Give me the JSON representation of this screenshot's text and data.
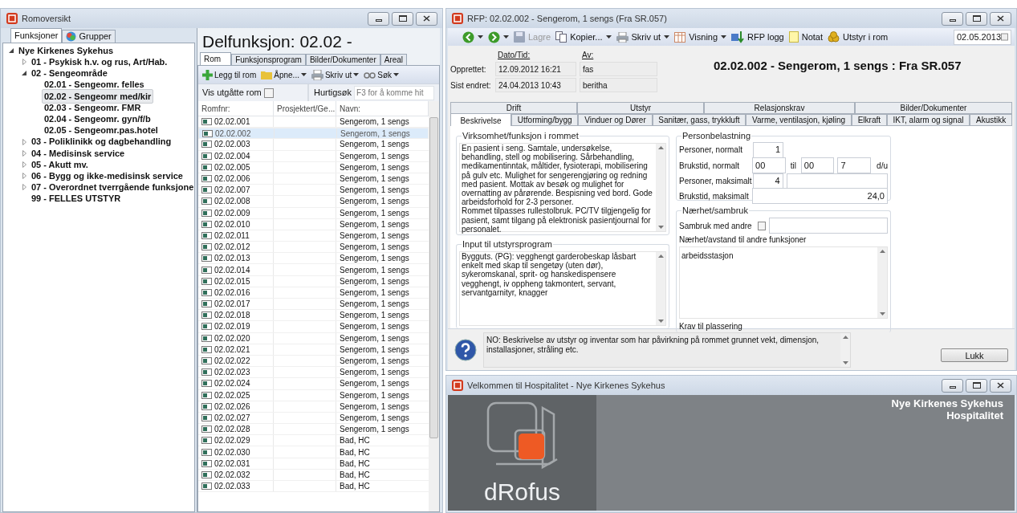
{
  "left_window": {
    "title": "Romoversikt",
    "tabs": [
      {
        "label": "Funksjoner",
        "selected": true
      },
      {
        "label": "Grupper",
        "selected": false
      }
    ],
    "tree": [
      {
        "label": "Nye Kirkenes Sykehus",
        "expanded": true,
        "selected": false,
        "children": [
          {
            "label": "01 - Psykisk h.v. og rus, Art/Hab.",
            "expanded": false,
            "selected": false
          },
          {
            "label": "02 - Sengeområde",
            "expanded": true,
            "selected": false,
            "children": [
              {
                "label": "02.01 - Sengeomr. felles",
                "selected": false
              },
              {
                "label": "02.02 - Sengeomr med/kir",
                "selected": true
              },
              {
                "label": "02.03 - Sengeomr. FMR",
                "selected": false
              },
              {
                "label": "02.04 - Sengeomr. gyn/f/b",
                "selected": false
              },
              {
                "label": "02.05 - Sengeomr.pas.hotel",
                "selected": false
              }
            ]
          },
          {
            "label": "03 - Poliklinikk og dagbehandling",
            "expanded": false,
            "selected": false
          },
          {
            "label": "04 - Medisinsk service",
            "expanded": false,
            "selected": false
          },
          {
            "label": "05 - Akutt mv.",
            "expanded": false,
            "selected": false
          },
          {
            "label": "06 - Bygg og ikke-medisinsk service",
            "expanded": false,
            "selected": false
          },
          {
            "label": "07 - Overordnet tverrgående funksjone",
            "expanded": false,
            "selected": false
          },
          {
            "label": "99 - FELLES UTSTYR",
            "selected": false
          }
        ]
      }
    ],
    "heading": "Delfunksjon: 02.02 -",
    "sub_tabs": [
      {
        "label": "Rom",
        "selected": true
      },
      {
        "label": "Funksjonsprogram",
        "selected": false
      },
      {
        "label": "Bilder/Dokumenter",
        "selected": false
      },
      {
        "label": "Areal",
        "selected": false
      }
    ],
    "toolbar": [
      {
        "label": "Legg til rom",
        "kind": "add",
        "dropdown": false
      },
      {
        "label": "Åpne...",
        "kind": "folder",
        "dropdown": true
      },
      {
        "label": "Skriv ut",
        "kind": "printer",
        "dropdown": true
      },
      {
        "label": "Søk",
        "kind": "glasses",
        "dropdown": true
      }
    ],
    "show_expired": {
      "label": "Vis utgåtte rom",
      "checked": false
    },
    "quick_search": {
      "label": "Hurtigsøk",
      "placeholder": "F3 for å komme hit"
    },
    "table": {
      "columns": [
        "Romfnr:",
        "Prosjektert/Ge...",
        "Navn:"
      ],
      "rows": [
        {
          "id": "02.02.001",
          "name": "Sengerom, 1 sengs",
          "selected": false
        },
        {
          "id": "02.02.002",
          "name": "Sengerom, 1 sengs",
          "selected": true
        },
        {
          "id": "02.02.003",
          "name": "Sengerom, 1 sengs",
          "selected": false
        },
        {
          "id": "02.02.004",
          "name": "Sengerom, 1 sengs",
          "selected": false
        },
        {
          "id": "02.02.005",
          "name": "Sengerom, 1 sengs",
          "selected": false
        },
        {
          "id": "02.02.006",
          "name": "Sengerom, 1 sengs",
          "selected": false
        },
        {
          "id": "02.02.007",
          "name": "Sengerom, 1 sengs",
          "selected": false
        },
        {
          "id": "02.02.008",
          "name": "Sengerom, 1 sengs",
          "selected": false
        },
        {
          "id": "02.02.009",
          "name": "Sengerom, 1 sengs",
          "selected": false
        },
        {
          "id": "02.02.010",
          "name": "Sengerom, 1 sengs",
          "selected": false
        },
        {
          "id": "02.02.011",
          "name": "Sengerom, 1 sengs",
          "selected": false
        },
        {
          "id": "02.02.012",
          "name": "Sengerom, 1 sengs",
          "selected": false
        },
        {
          "id": "02.02.013",
          "name": "Sengerom, 1 sengs",
          "selected": false
        },
        {
          "id": "02.02.014",
          "name": "Sengerom, 1 sengs",
          "selected": false
        },
        {
          "id": "02.02.015",
          "name": "Sengerom, 1 sengs",
          "selected": false
        },
        {
          "id": "02.02.016",
          "name": "Sengerom, 1 sengs",
          "selected": false
        },
        {
          "id": "02.02.017",
          "name": "Sengerom, 1 sengs",
          "selected": false
        },
        {
          "id": "02.02.018",
          "name": "Sengerom, 1 sengs",
          "selected": false
        },
        {
          "id": "02.02.019",
          "name": "Sengerom, 1 sengs",
          "selected": false
        },
        {
          "id": "02.02.020",
          "name": "Sengerom, 1 sengs",
          "selected": false
        },
        {
          "id": "02.02.021",
          "name": "Sengerom, 1 sengs",
          "selected": false
        },
        {
          "id": "02.02.022",
          "name": "Sengerom, 1 sengs",
          "selected": false
        },
        {
          "id": "02.02.023",
          "name": "Sengerom, 1 sengs",
          "selected": false
        },
        {
          "id": "02.02.024",
          "name": "Sengerom, 1 sengs",
          "selected": false
        },
        {
          "id": "02.02.025",
          "name": "Sengerom, 1 sengs",
          "selected": false
        },
        {
          "id": "02.02.026",
          "name": "Sengerom, 1 sengs",
          "selected": false
        },
        {
          "id": "02.02.027",
          "name": "Sengerom, 1 sengs",
          "selected": false
        },
        {
          "id": "02.02.028",
          "name": "Sengerom, 1 sengs",
          "selected": false
        },
        {
          "id": "02.02.029",
          "name": "Bad, HC",
          "selected": false
        },
        {
          "id": "02.02.030",
          "name": "Bad, HC",
          "selected": false
        },
        {
          "id": "02.02.031",
          "name": "Bad, HC",
          "selected": false
        },
        {
          "id": "02.02.032",
          "name": "Bad, HC",
          "selected": false
        },
        {
          "id": "02.02.033",
          "name": "Bad, HC",
          "selected": false
        }
      ]
    }
  },
  "rfp_window": {
    "title": "RFP: 02.02.002 - Sengerom, 1 sengs (Fra SR.057)",
    "toolbar": [
      {
        "kind": "back",
        "dropdown": true,
        "disabled": false
      },
      {
        "kind": "forward",
        "dropdown": true,
        "disabled": false
      },
      {
        "kind": "save",
        "label": "Lagre",
        "dropdown": false,
        "disabled": true
      },
      {
        "kind": "copy",
        "label": "Kopier...",
        "dropdown": true,
        "disabled": false
      },
      {
        "kind": "printer",
        "label": "Skriv ut",
        "dropdown": true,
        "disabled": false
      },
      {
        "kind": "grid",
        "label": "Visning",
        "dropdown": true,
        "disabled": false
      },
      {
        "kind": "log",
        "label": "RFP logg",
        "dropdown": false,
        "disabled": false
      },
      {
        "kind": "note",
        "label": "Notat",
        "dropdown": false,
        "disabled": false
      },
      {
        "kind": "coins",
        "label": "Utstyr i rom",
        "dropdown": false,
        "disabled": false
      }
    ],
    "date": "02.05.2013",
    "info_headers": [
      "Dato/Tid:",
      "Av:"
    ],
    "info_rows": [
      {
        "label": "Opprettet:",
        "date": "12.09.2012 16:21",
        "by": "fas"
      },
      {
        "label": "Sist endret:",
        "date": "24.04.2013 10:43",
        "by": "beritha"
      }
    ],
    "heading": "02.02.002 - Sengerom, 1 sengs : Fra SR.057",
    "tabs_row1": [
      {
        "label": "Drift",
        "selected": false
      },
      {
        "label": "Utstyr",
        "selected": false
      },
      {
        "label": "Relasjonskrav",
        "selected": false
      },
      {
        "label": "Bilder/Dokumenter",
        "selected": false
      }
    ],
    "tabs_row2": [
      {
        "label": "Beskrivelse",
        "selected": true
      },
      {
        "label": "Utforming/bygg",
        "selected": false
      },
      {
        "label": "Vinduer og Dører",
        "selected": false
      },
      {
        "label": "Sanitær, gass, trykkluft",
        "selected": false
      },
      {
        "label": "Varme, ventilasjon, kjøling",
        "selected": false
      },
      {
        "label": "Elkraft",
        "selected": false
      },
      {
        "label": "IKT, alarm og signal",
        "selected": false
      },
      {
        "label": "Akustikk",
        "selected": false
      }
    ],
    "activity": {
      "title": "Virksomhet/funksjon i rommet",
      "text": "En pasient i seng. Samtale, undersøkelse, behandling, stell og mobilisering. Sårbehandling, medikamentinntak, måltider, fysioterapi, mobilisering på gulv etc. Mulighet for sengerengjøring og redning med pasient. Mottak av besøk og mulighet for overnatting av pårørende. Bespisning ved bord. Gode arbeidsforhold for 2-3 personer.\nRommet tilpasses rullestolbruk. PC/TV tilgjengelig for pasient, samt tilgang på elektronisk pasientjournal for personalet."
    },
    "equipment_input": {
      "title": "Input til utstyrsprogram",
      "text": "Bygguts. (PG): vegghengt garderobeskap låsbart enkelt med skap til sengetøy (uten dør), sykeromskanal, sprit- og hanskedispensere vegghengt, iv oppheng takmontert, servant, servantgarnityr, knagger"
    },
    "occupancy": {
      "title": "Personbelastning",
      "persons_normal_label": "Personer, normalt",
      "persons_normal": "1",
      "usage_normal_label": "Brukstid, normalt",
      "usage_from": "00",
      "to_label": "til",
      "usage_to": "00",
      "days": "7",
      "days_unit": "d/u",
      "persons_max_label": "Personer, maksimalt",
      "persons_max": "4",
      "usage_max_label": "Brukstid, maksimalt",
      "usage_max": "24,0"
    },
    "proximity": {
      "title": "Nærhet/sambruk",
      "shared_label": "Sambruk med andre",
      "shared": false,
      "distance_label": "Nærhet/avstand til andre funksjoner",
      "distance_text": "arbeidsstasjon",
      "placement_label": "Krav til plassering"
    },
    "help_text": "NO: Beskrivelse av utstyr og inventar som har påvirkning på rommet grunnet vekt, dimensjon, installasjoner, stråling etc.",
    "close_button": "Lukk"
  },
  "welcome_window": {
    "title": "Velkommen til Hospitalitet - Nye Kirkenes Sykehus",
    "logo_text": "dRofus",
    "project": "Nye Kirkenes Sykehus",
    "product": "Hospitalitet"
  }
}
